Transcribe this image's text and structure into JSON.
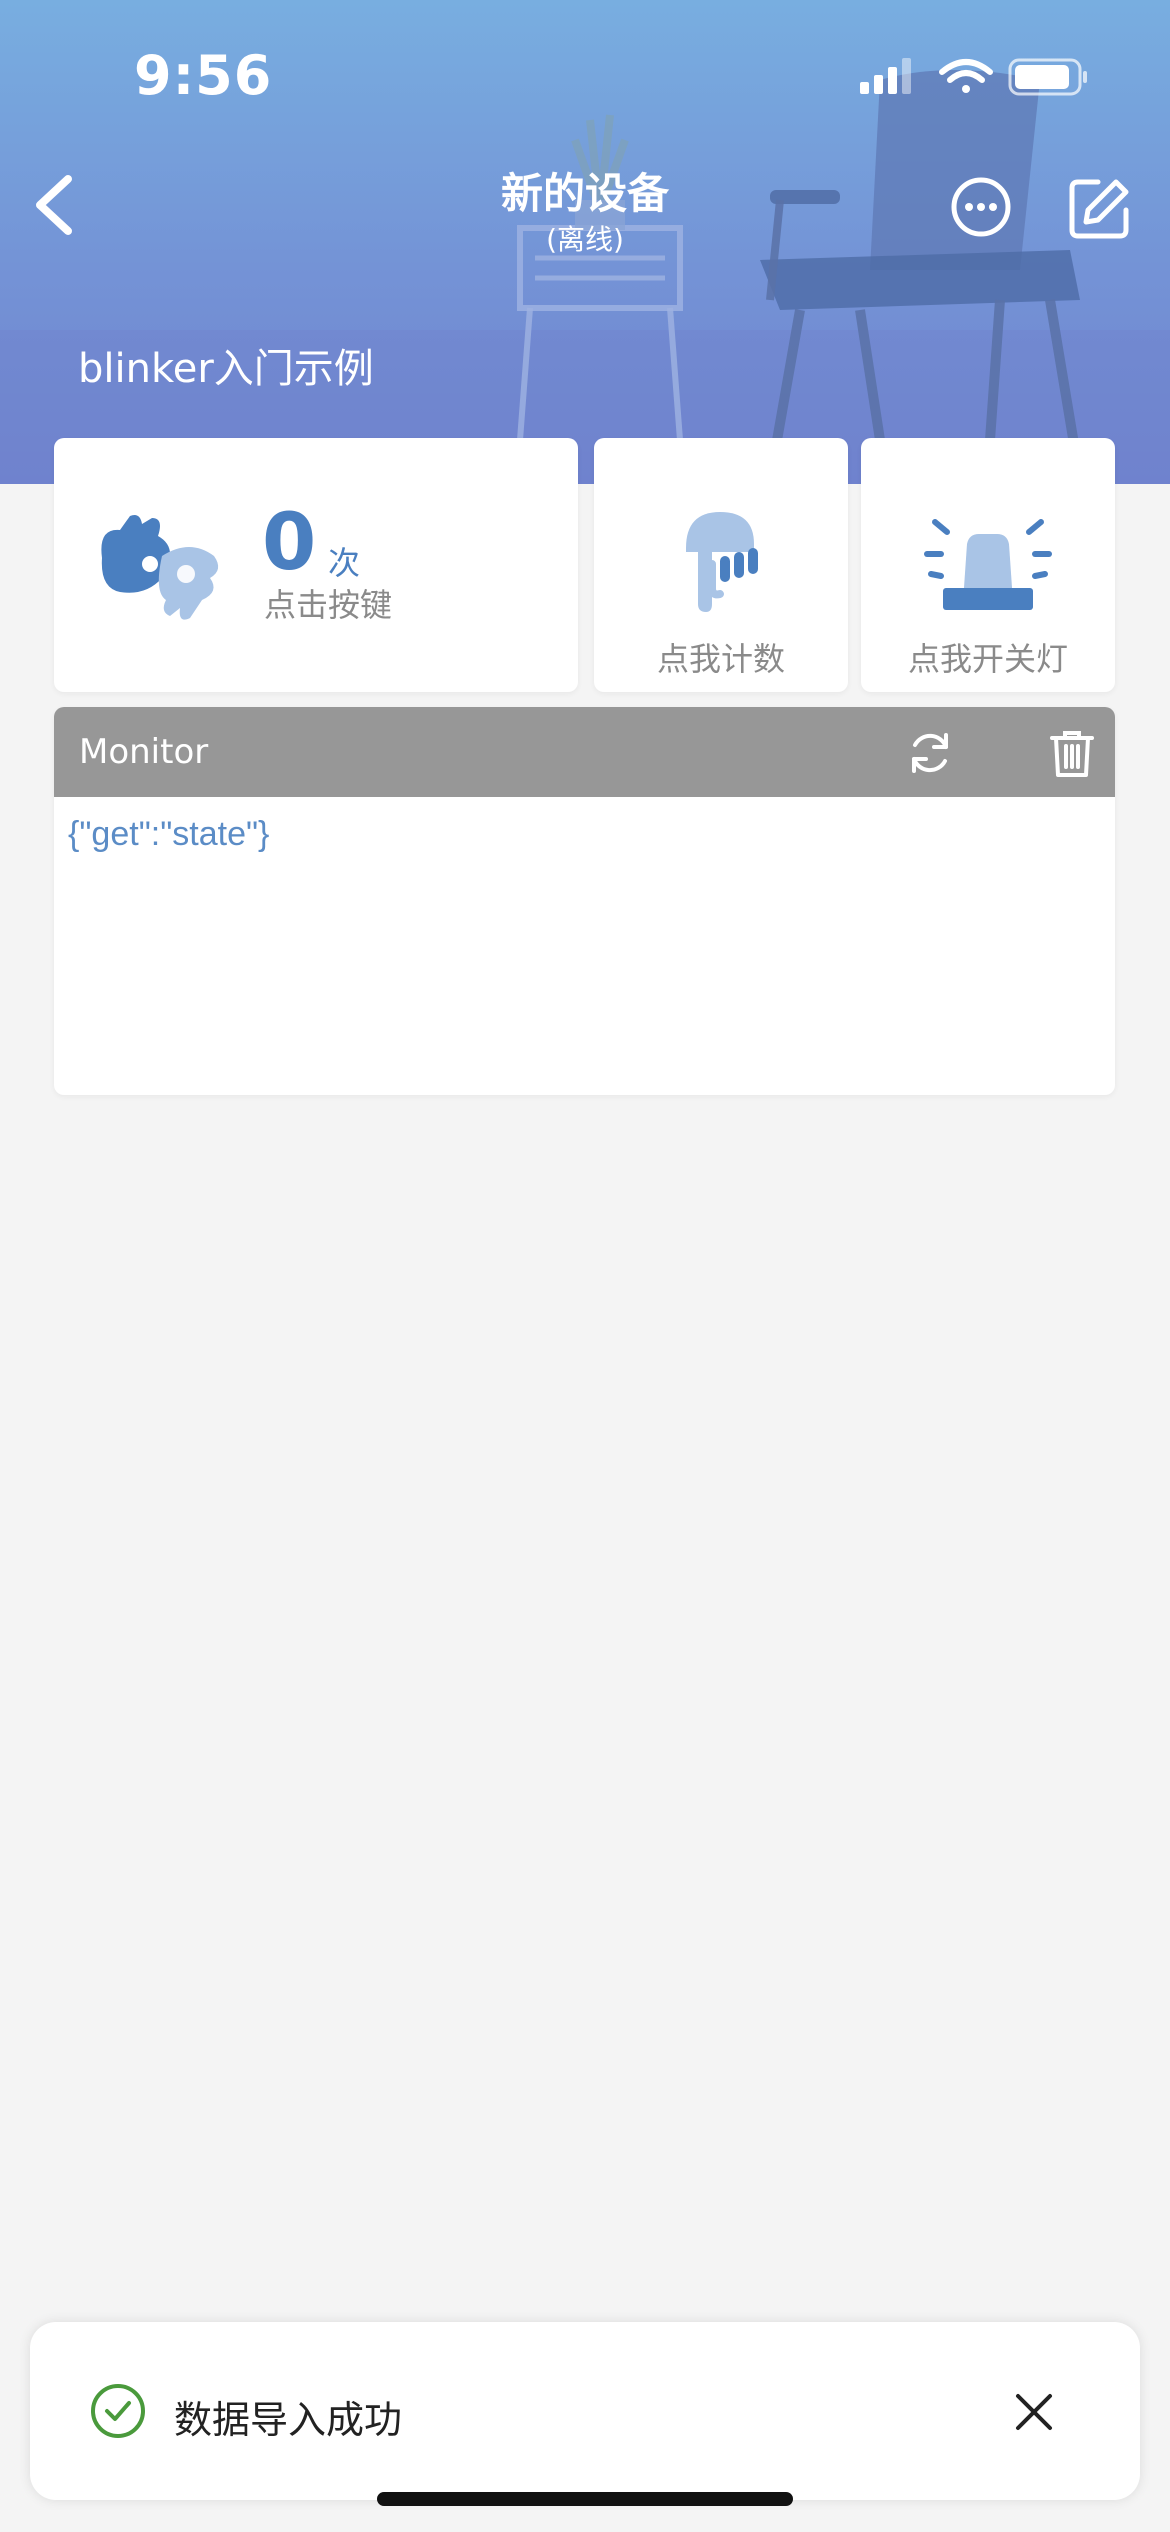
{
  "status_bar": {
    "time": "9:56"
  },
  "nav": {
    "title": "新的设备",
    "subtitle": "(离线)",
    "back_icon": "chevron-left-icon",
    "more_icon": "more-circle-icon",
    "edit_icon": "edit-icon"
  },
  "device": {
    "name": "blinker入门示例"
  },
  "widgets": {
    "counter": {
      "value": "0",
      "unit": "次",
      "label": "点击按键",
      "icon": "hand-sign-icon"
    },
    "count_button": {
      "label": "点我计数",
      "icon": "tap-icon"
    },
    "light_button": {
      "label": "点我开关灯",
      "icon": "alarm-light-icon"
    }
  },
  "monitor": {
    "title": "Monitor",
    "refresh_icon": "refresh-icon",
    "delete_icon": "trash-icon",
    "content": "{\"get\":\"state\"}"
  },
  "toast": {
    "message": "数据导入成功",
    "success_icon": "check-circle-icon",
    "close_icon": "close-icon"
  },
  "colors": {
    "header_top": "#78aee0",
    "header_bottom": "#6f83cf",
    "accent_blue": "#4a7fc0",
    "icon_light_blue": "#a9c4e6",
    "monitor_header": "#979797",
    "success_green": "#4a9a3c",
    "background": "#f4f4f4"
  }
}
